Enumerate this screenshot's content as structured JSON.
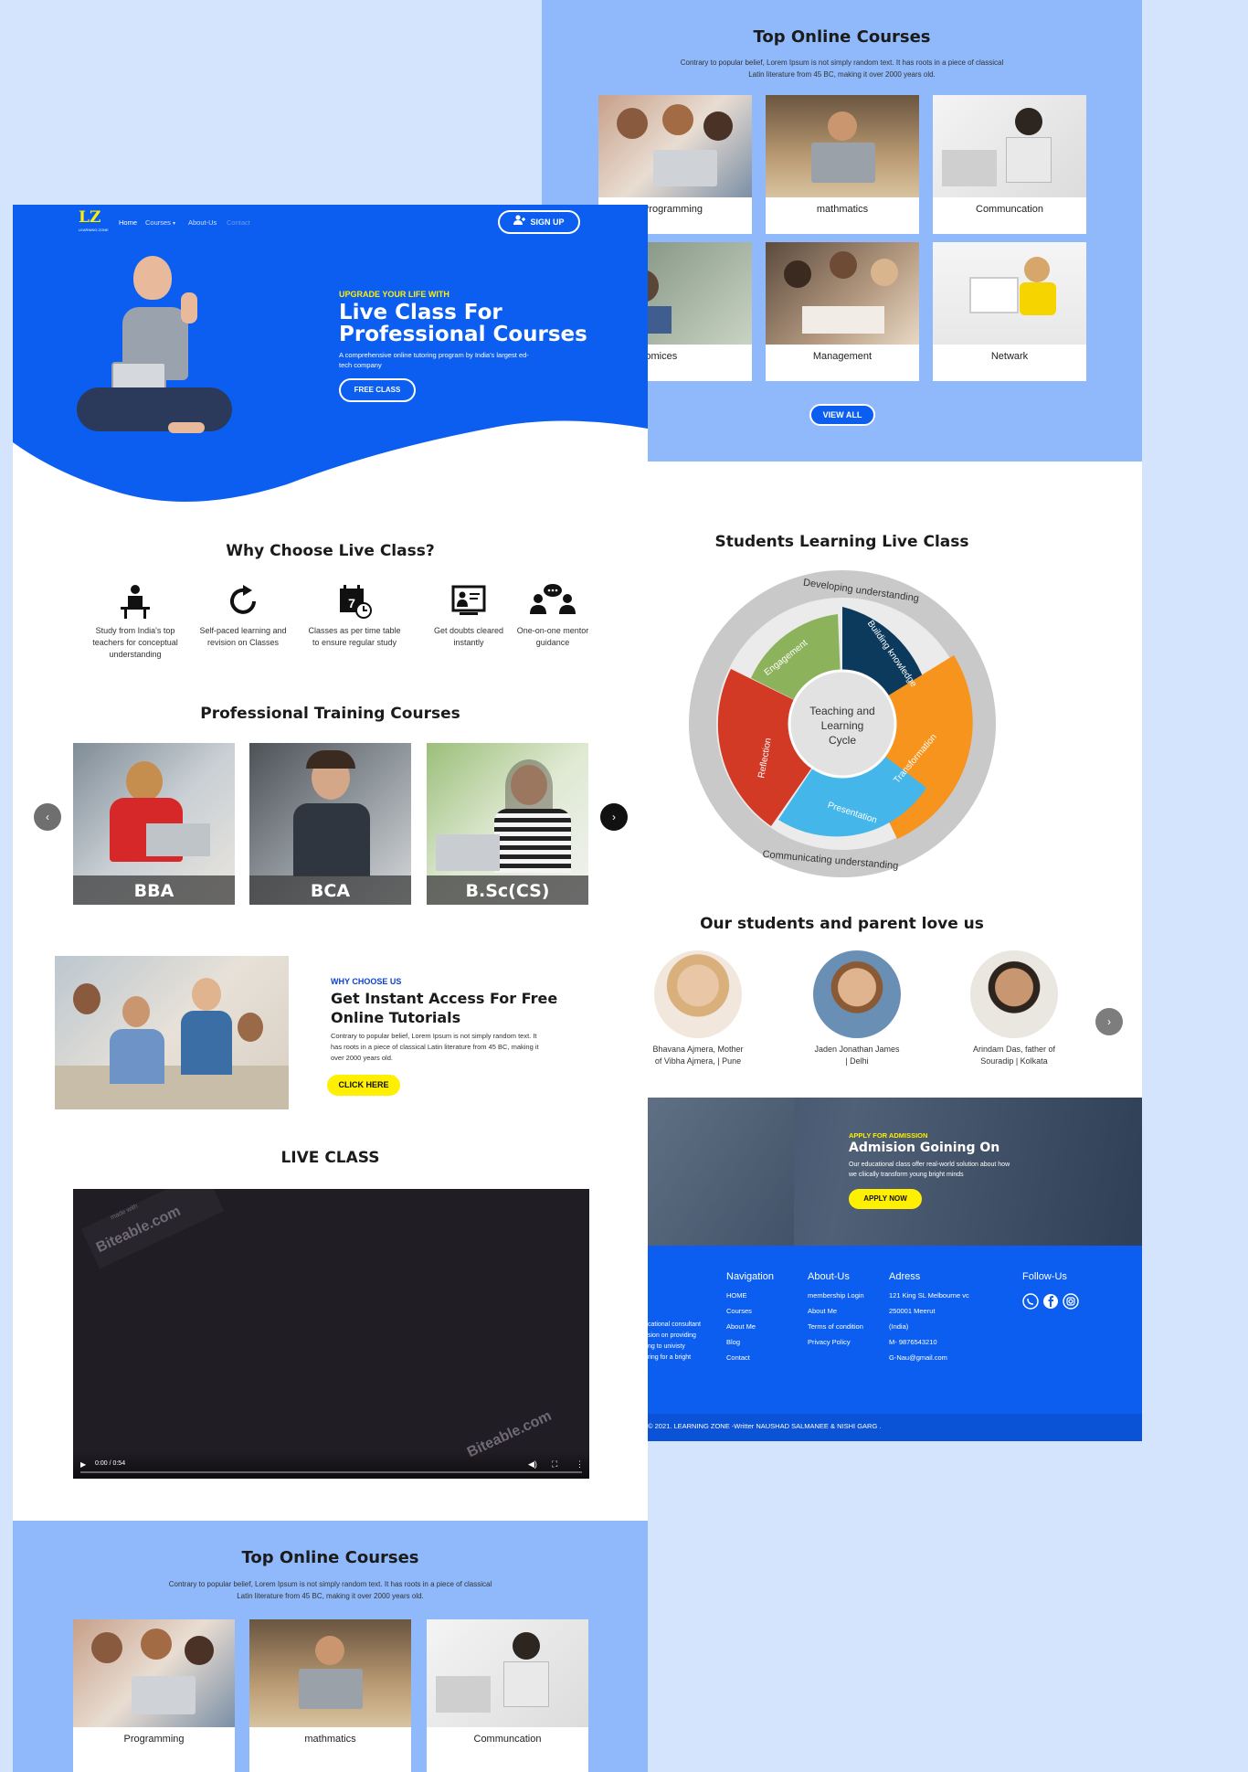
{
  "nav": {
    "logo": "LZ",
    "logo_sub": "LEARNING ZONE",
    "home": "Home",
    "courses": "Courses",
    "about": "About-Us",
    "contact": "Contact",
    "signup": "SIGN UP"
  },
  "hero": {
    "eyebrow": "UPGRADE YOUR LIFE WITH",
    "title_line1": "Live Class For",
    "title_line2": "Professional Courses",
    "desc": "A comprehensive online tutoring program by India's largest ed-tech company",
    "cta": "FREE CLASS"
  },
  "why": {
    "title": "Why Choose Live Class?",
    "items": [
      {
        "text": "Study from India's top teachers for conceptual understanding"
      },
      {
        "text": "Self-paced learning and revision on Classes"
      },
      {
        "text": "Classes as per time table to ensure regular study"
      },
      {
        "text": "Get doubts cleared instantly"
      },
      {
        "text": "One-on-one mentor guidance"
      }
    ]
  },
  "training": {
    "title": "Professional Training Courses",
    "cards": [
      {
        "label": "BBA"
      },
      {
        "label": "BCA"
      },
      {
        "label": "B.Sc(CS)"
      }
    ],
    "prev": "‹",
    "next": "›"
  },
  "free": {
    "eyebrow": "WHY CHOOSE US",
    "title_line1": "Get Instant Access For Free",
    "title_line2": "Online Tutorials",
    "desc": "Contrary to popular belief, Lorem Ipsum is not simply random text. It has roots in a piece of classical Latin literature from 45 BC, making it over 2000 years old.",
    "cta": "CLICK HERE"
  },
  "live": {
    "title": "LIVE CLASS",
    "watermark": "Biteable.com",
    "watermark_small": "made with",
    "time": "0:00 / 0:54"
  },
  "top_courses": {
    "title": "Top Online Courses",
    "desc_line1": "Contrary to popular belief, Lorem Ipsum is not simply random text. It has roots in a piece of classical",
    "desc_line2": "Latin literature from 45 BC, making it over 2000 years old.",
    "cards": [
      {
        "label": "Programming"
      },
      {
        "label": "mathmatics"
      },
      {
        "label": "Communcation"
      },
      {
        "label": "ness Economices"
      },
      {
        "label": "Management"
      },
      {
        "label": "Netwark"
      }
    ],
    "view_all": "VIEW ALL"
  },
  "cycle": {
    "title": "Students Learning Live Class",
    "center_l1": "Teaching and",
    "center_l2": "Learning",
    "center_l3": "Cycle",
    "outer_top": "Developing understanding",
    "outer_bottom": "Communicating understanding",
    "seg_building": "Building knowledge",
    "seg_transformation": "Transformation",
    "seg_presentation": "Presentation",
    "seg_reflection": "Reflection",
    "seg_engagement": "Engagement"
  },
  "testimonials": {
    "title": "Our students and parent love us",
    "people": [
      {
        "name_l1": "Bhavana Ajmera, Mother",
        "name_l2": "of Vibha Ajmera, | Pune"
      },
      {
        "name_l1": "Jaden Jonathan James",
        "name_l2": "| Delhi"
      },
      {
        "name_l1": "Arindam Das, father of",
        "name_l2": "Souradip | Kolkata"
      }
    ],
    "next": "›"
  },
  "admission": {
    "eyebrow": "APPLY FOR ADMISSION",
    "title": "Admision Goining On",
    "desc_l1": "Our educational class offer real-world solution about how",
    "desc_l2": "we cliically transform young bright minds",
    "cta": "APPLY NOW"
  },
  "footer": {
    "about_text": [
      "cational consultant",
      "sion on providing",
      "ng to univisty",
      "ring for a bright"
    ],
    "navigation": {
      "title": "Navigation",
      "items": [
        "HOME",
        "Courses",
        "About Me",
        "Blog",
        "Contact"
      ]
    },
    "about": {
      "title": "About-Us",
      "items": [
        "membership Login",
        "About Me",
        "Terms of condition",
        "Privacy Policy"
      ]
    },
    "address": {
      "title": "Adress",
      "items": [
        "121 King SL Melbourne vc",
        "250001 Meerut",
        "(India)",
        "M- 9876543210",
        "G-Nau@gmail.com"
      ]
    },
    "follow": {
      "title": "Follow-Us"
    },
    "copyright": "© 2021. LEARNING ZONE -Writter NAUSHAD SALMANEE & NISHI GARG ."
  },
  "colors": {
    "brand_blue": "#0b5ef0",
    "light_blue": "#8fb9fb",
    "yellow": "#ffef00",
    "bg": "#d4e4fd"
  }
}
